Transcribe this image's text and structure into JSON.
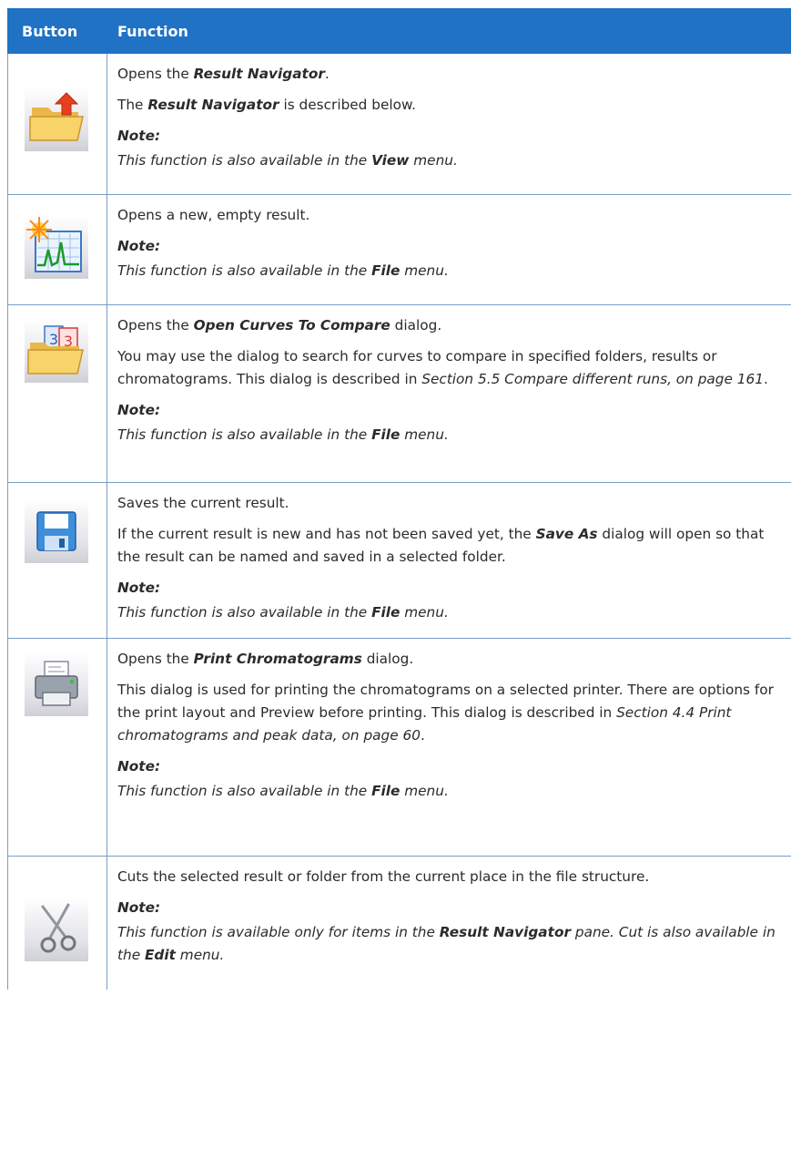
{
  "header": {
    "button": "Button",
    "function": "Function"
  },
  "common": {
    "note": "Note:",
    "menu_suffix": " menu.",
    "also_prefix": "This function is also available in the "
  },
  "rows": [
    {
      "icon": "open-folder-arrow-icon",
      "l1a": "Opens the ",
      "l1b": "Result Navigator",
      "l1c": ".",
      "l2a": "The ",
      "l2b": "Result Navigator",
      "l2c": " is described below.",
      "menu": "View"
    },
    {
      "icon": "new-result-chart-icon",
      "l1": "Opens a new, empty result.",
      "menu": "File"
    },
    {
      "icon": "compare-curves-folder-icon",
      "l1a": "Opens the ",
      "l1b": "Open Curves To Compare",
      "l1c": " dialog.",
      "l2a": "You may use the dialog to search for curves to compare in specified folders, results or chromatograms. This dialog is described in ",
      "l2b": "Section 5.5 Compare different runs, on page 161",
      "l2c": ".",
      "menu": "File"
    },
    {
      "icon": "save-floppy-icon",
      "l1": "Saves the current result.",
      "l2a": "If the current result is new and has not been saved yet, the ",
      "l2b": "Save As",
      "l2c": " dialog will open so that the result can be named and saved in a selected folder.",
      "menu": "File"
    },
    {
      "icon": "printer-icon",
      "l1a": "Opens the ",
      "l1b": "Print Chromatograms",
      "l1c": " dialog.",
      "l2a": "This dialog is used for printing the chromatograms on a selected printer. There are options for the print layout and Preview before printing. This dialog is described in ",
      "l2b": "Section 4.4 Print chromatograms and peak data, on page 60",
      "l2c": ".",
      "menu": "File"
    },
    {
      "icon": "scissors-icon",
      "l1": "Cuts the selected result or folder from the current place in the file structure.",
      "n1": "This function is available only for items in the ",
      "n2": "Result Navigator",
      "n3": " pane. Cut is also available in the ",
      "n4": "Edit",
      "n5": " menu."
    }
  ]
}
